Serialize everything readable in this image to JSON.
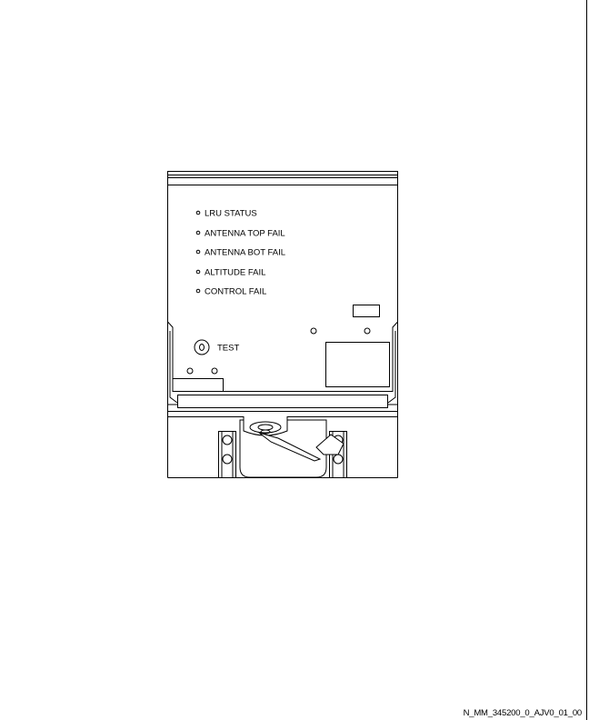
{
  "panel": {
    "indicators": [
      {
        "label": "LRU STATUS"
      },
      {
        "label": "ANTENNA TOP FAIL"
      },
      {
        "label": "ANTENNA BOT FAIL"
      },
      {
        "label": "ALTITUDE FAIL"
      },
      {
        "label": "CONTROL FAIL"
      }
    ],
    "test_button_label": "TEST"
  },
  "figure_id": "N_MM_345200_0_AJV0_01_00"
}
